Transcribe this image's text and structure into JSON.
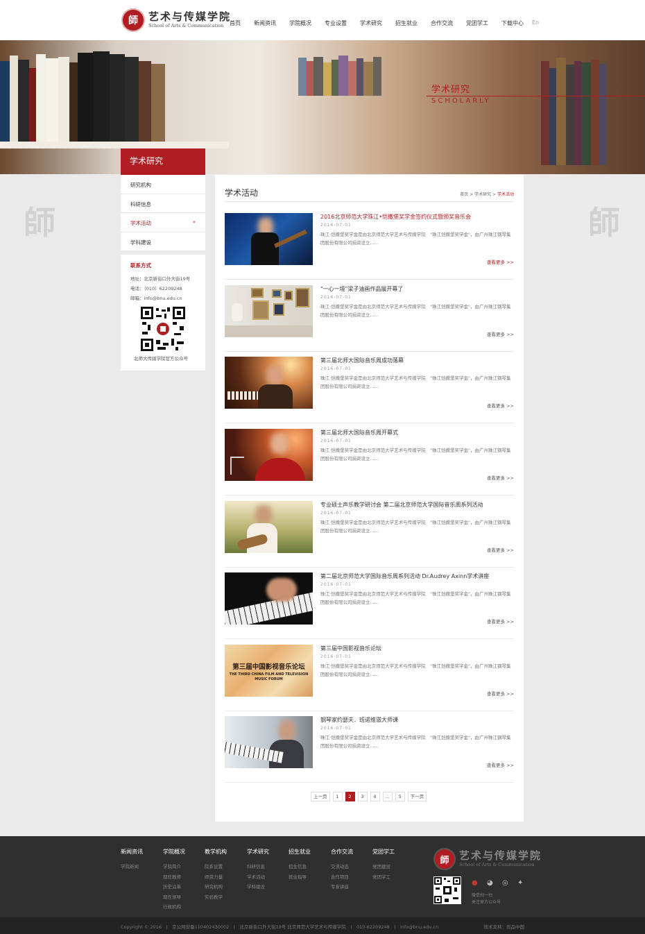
{
  "header": {
    "logo_cn": "艺术与传媒学院",
    "logo_en": "School of Arts & Communication",
    "nav": [
      "首页",
      "新闻资讯",
      "学院概况",
      "专业设置",
      "学术研究",
      "招生就业",
      "合作交流",
      "党团学工",
      "下载中心",
      "En"
    ]
  },
  "banner": {
    "title_cn": "学术研究",
    "title_en": "SCHOLARLY"
  },
  "sidebar": {
    "heading": "学术研究",
    "items": [
      {
        "label": "研究机构"
      },
      {
        "label": "科研信息"
      },
      {
        "label": "学术活动"
      },
      {
        "label": "学科建设"
      }
    ],
    "active_arrow": "»",
    "contact": {
      "title": "联系方式",
      "address": "地址：北京新街口外大街19号",
      "phone": "电话：（010）62209248",
      "email": "邮箱：info@bnu.edu.cn",
      "qr_caption": "北师大传媒学院官方公众号"
    }
  },
  "main": {
    "title": "学术活动",
    "breadcrumb": {
      "home": "首页",
      "sep1": " > ",
      "parent": "学术研究",
      "sep2": " > ",
      "current": "学术活动"
    },
    "items": [
      {
        "title": "2016北京师范大学珠江•恺撒堡奖学金签约仪式暨颁奖音乐会",
        "date": "2016-07-01",
        "desc": "珠江·恺撒堡奖学金是由北京师范大学艺术与传媒学院　\"珠江恺撒堡奖学金\"，由广州珠江钢琴集团股份有限公司捐资设立......",
        "more": "查看更多 >>"
      },
      {
        "title": "\"一心一境\"梁子油画作品展开幕了",
        "date": "2016-07-01",
        "desc": "珠江·恺撒堡奖学金是由北京师范大学艺术与传媒学院　\"珠江恺撒堡奖学金\"，由广州珠江钢琴集团股份有限公司捐资设立......",
        "more": "查看更多 >>"
      },
      {
        "title": "第三届北师大国际音乐周成功落幕",
        "date": "2016-07-01",
        "desc": "珠江·恺撒堡奖学金是由北京师范大学艺术与传媒学院　\"珠江恺撒堡奖学金\"，由广州珠江钢琴集团股份有限公司捐资设立......",
        "more": "查看更多 >>"
      },
      {
        "title": "第三届北师大国际音乐周开幕式",
        "date": "2016-07-01",
        "desc": "珠江·恺撒堡奖学金是由北京师范大学艺术与传媒学院　\"珠江恺撒堡奖学金\"，由广州珠江钢琴集团股份有限公司捐资设立......",
        "more": "查看更多 >>"
      },
      {
        "title": "专业硕士声乐教学研讨会 第二届北京师范大学国际音乐周系列活动",
        "date": "2016-07-01",
        "desc": "珠江·恺撒堡奖学金是由北京师范大学艺术与传媒学院　\"珠江恺撒堡奖学金\"，由广州珠江钢琴集团股份有限公司捐资设立......",
        "more": "查看更多 >>"
      },
      {
        "title": "第二届北京师范大学国际音乐周系列活动 Dr.Audrey Axinn学术讲座",
        "date": "2016-07-01",
        "desc": "珠江·恺撒堡奖学金是由北京师范大学艺术与传媒学院　\"珠江恺撒堡奖学金\"，由广州珠江钢琴集团股份有限公司捐资设立......",
        "more": "查看更多 >>"
      },
      {
        "title": "第三届中国影视音乐论坛",
        "date": "2016-07-01",
        "desc": "珠江·恺撒堡奖学金是由北京师范大学艺术与传媒学院　\"珠江恺撒堡奖学金\"，由广州珠江钢琴集团股份有限公司捐资设立......",
        "more": "查看更多 >>",
        "thumb_cn": "第三届中国影视音乐论坛",
        "thumb_en": "THE THIRD CHINA FILM AND TELEVISION MUSIC FORUM"
      },
      {
        "title": "钢琴家约瑟夫．班诺维滋大师课",
        "date": "2016-07-01",
        "desc": "珠江·恺撒堡奖学金是由北京师范大学艺术与传媒学院　\"珠江恺撒堡奖学金\"，由广州珠江钢琴集团股份有限公司捐资设立......",
        "more": "查看更多 >>"
      }
    ],
    "pager": [
      "上一页",
      "1",
      "2",
      "3",
      "4",
      "...",
      "5",
      "下一页"
    ]
  },
  "footer": {
    "cols": [
      {
        "head": "新闻资讯",
        "links": [
          "学院新闻"
        ]
      },
      {
        "head": "学院概况",
        "links": [
          "学院简介",
          "现任教师",
          "历史沿革",
          "现任领导",
          "行政机构"
        ]
      },
      {
        "head": "教学机构",
        "links": [
          "院系设置",
          "师资力量",
          "研究机构",
          "实验教学"
        ]
      },
      {
        "head": "学术研究",
        "links": [
          "科研信息",
          "学术活动",
          "学科建设"
        ]
      },
      {
        "head": "招生就业",
        "links": [
          "招生信息",
          "就业指导"
        ]
      },
      {
        "head": "合作交流",
        "links": [
          "交流动态",
          "合作项目",
          "专家讲座"
        ]
      },
      {
        "head": "党团学工",
        "links": [
          "党团建设",
          "党团学工"
        ]
      }
    ],
    "logo_cn": "艺术与传媒学院",
    "logo_en": "School of Arts & Communication",
    "follow1": "微信扫一扫",
    "follow2": "关注官方公众号",
    "bottom_left": "Copyright © 2016　|　京公网安备110402430002　|　北京新街口外大街19号 北京师范大学艺术与传媒学院　|　010-62209248　|　info@bnu.edu.cn",
    "bottom_right": "技术支持：尚品中国"
  }
}
